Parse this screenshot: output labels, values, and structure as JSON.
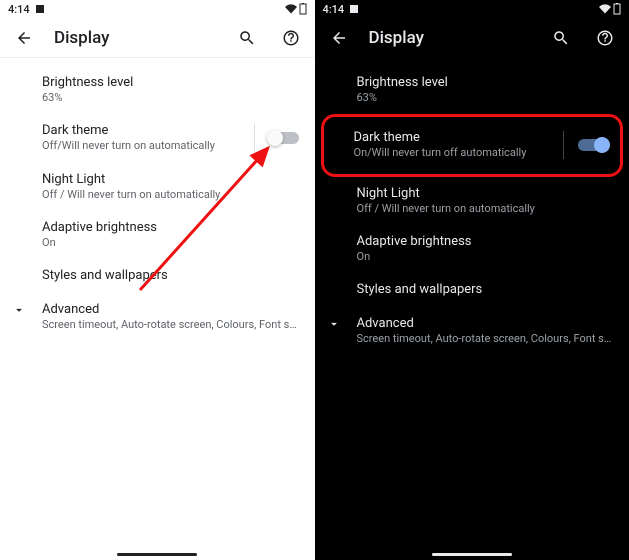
{
  "status": {
    "time": "4:14"
  },
  "header": {
    "title": "Display"
  },
  "left": {
    "brightness": {
      "title": "Brightness level",
      "sub": "63%"
    },
    "darktheme": {
      "title": "Dark theme",
      "sub": "Off/Will never turn on automatically"
    },
    "nightlight": {
      "title": "Night Light",
      "sub": "Off / Will never turn on automatically"
    },
    "adaptive": {
      "title": "Adaptive brightness",
      "sub": "On"
    },
    "styles": {
      "title": "Styles and wallpapers"
    },
    "advanced": {
      "title": "Advanced",
      "sub": "Screen timeout, Auto-rotate screen, Colours, Font s…"
    }
  },
  "right": {
    "brightness": {
      "title": "Brightness level",
      "sub": "63%"
    },
    "darktheme": {
      "title": "Dark theme",
      "sub": "On/Will never turn off automatically"
    },
    "nightlight": {
      "title": "Night Light",
      "sub": "Off / Will never turn on automatically"
    },
    "adaptive": {
      "title": "Adaptive brightness",
      "sub": "On"
    },
    "styles": {
      "title": "Styles and wallpapers"
    },
    "advanced": {
      "title": "Advanced",
      "sub": "Screen timeout, Auto-rotate screen, Colours, Font s…"
    }
  }
}
